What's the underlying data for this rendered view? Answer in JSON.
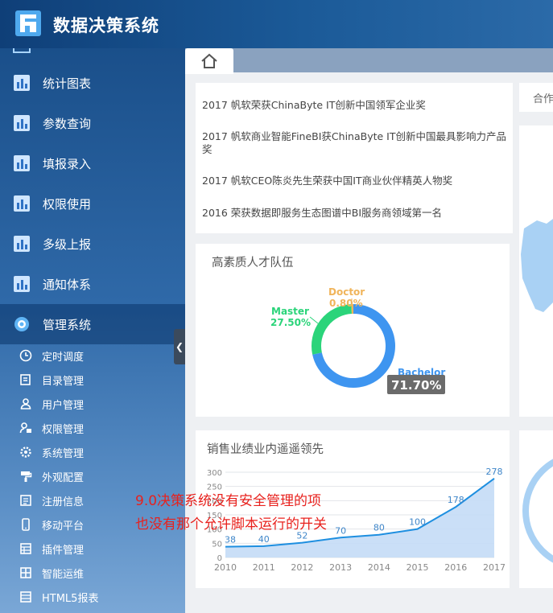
{
  "header": {
    "title": "数据决策系统"
  },
  "sidebar": {
    "items": [
      {
        "label": "统计图表",
        "icon": "chart-icon"
      },
      {
        "label": "参数查询",
        "icon": "query-icon"
      },
      {
        "label": "填报录入",
        "icon": "form-icon"
      },
      {
        "label": "权限使用",
        "icon": "permission-icon"
      },
      {
        "label": "多级上报",
        "icon": "report-icon"
      },
      {
        "label": "通知体系",
        "icon": "notice-icon"
      },
      {
        "label": "管理系统",
        "icon": "gear-icon"
      }
    ],
    "sub_items": [
      {
        "label": "定时调度",
        "icon": "clock-icon"
      },
      {
        "label": "目录管理",
        "icon": "folder-icon"
      },
      {
        "label": "用户管理",
        "icon": "user-icon"
      },
      {
        "label": "权限管理",
        "icon": "lock-icon"
      },
      {
        "label": "系统管理",
        "icon": "gear-icon"
      },
      {
        "label": "外观配置",
        "icon": "paint-icon"
      },
      {
        "label": "注册信息",
        "icon": "register-icon"
      },
      {
        "label": "移动平台",
        "icon": "mobile-icon"
      },
      {
        "label": "插件管理",
        "icon": "plugin-icon"
      },
      {
        "label": "智能运维",
        "icon": "ops-icon"
      },
      {
        "label": "HTML5报表",
        "icon": "html5-icon"
      }
    ]
  },
  "tabs": {
    "partial": "合作"
  },
  "news": [
    "2017 帆软荣获ChinaByte IT创新中国领军企业奖",
    "2017 帆软商业智能FineBI获ChinaByte IT创新中国最具影响力产品奖",
    "2017 帆软CEO陈炎先生荣获中国IT商业伙伴精英人物奖",
    "2016 荣获数据即服务生态图谱中BI服务商领域第一名"
  ],
  "talent_card": {
    "title": "高素质人才队伍"
  },
  "sales_card": {
    "title": "销售业绩业内遥遥领先"
  },
  "note": {
    "line1": "9.0决策系统没有安全管理的项",
    "line2": "也没有那个允许脚本运行的开关"
  },
  "colors": {
    "bachelor": "#3e95f0",
    "master": "#2bd47a",
    "doctor": "#f0b45a",
    "line": "#1e8fe0",
    "area": "#c4dcf6"
  },
  "chart_data": [
    {
      "type": "pie",
      "title": "",
      "series": [
        {
          "name": "Bachelor",
          "label": "71.70%",
          "value": 71.7
        },
        {
          "name": "Master",
          "label": "27.50%",
          "value": 27.5
        },
        {
          "name": "Doctor",
          "label": "0.80%",
          "value": 0.8
        }
      ]
    },
    {
      "type": "area",
      "title": "",
      "x": [
        "2010",
        "2011",
        "2012",
        "2013",
        "2014",
        "2015",
        "2016",
        "2017"
      ],
      "values": [
        38,
        40,
        52,
        70,
        80,
        100,
        178,
        278
      ],
      "yticks": [
        "300",
        "250",
        "200",
        "150",
        "100",
        "50",
        "0"
      ],
      "ylim": [
        0,
        300
      ],
      "grid": true
    }
  ]
}
